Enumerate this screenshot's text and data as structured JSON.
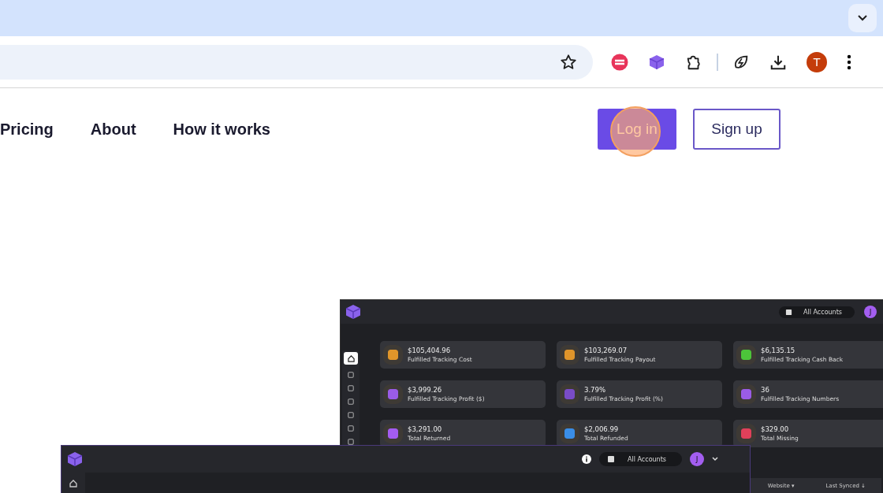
{
  "browser": {
    "avatar_initial": "T"
  },
  "nav": {
    "links": [
      {
        "label": "Pricing"
      },
      {
        "label": "About"
      },
      {
        "label": "How it works"
      }
    ],
    "login": {
      "label": "Log in",
      "click_highlight": true
    },
    "signup": {
      "label": "Sign up"
    }
  },
  "back_dashboard": {
    "account_label": "All Accounts",
    "avatar_initial": "J",
    "cards": [
      {
        "value": "$105,404.96",
        "label": "Fulfilled Tracking Cost",
        "color": "#e0952a"
      },
      {
        "value": "$103,269.07",
        "label": "Fulfilled Tracking Payout",
        "color": "#e0952a"
      },
      {
        "value": "$6,135.15",
        "label": "Fulfilled Tracking Cash Back",
        "color": "#4cc43a"
      },
      {
        "value": "$3,999.26",
        "label": "Fulfilled Tracking Profit ($)",
        "color": "#9a5ce6"
      },
      {
        "value": "3.79%",
        "label": "Fulfilled Tracking Profit (%)",
        "color": "#7a4cc6"
      },
      {
        "value": "36",
        "label": "Fulfilled Tracking Numbers",
        "color": "#9a5ce6"
      },
      {
        "value": "$3,291.00",
        "label": "Total Returned",
        "color": "#a45cf0"
      },
      {
        "value": "$2,006.99",
        "label": "Total Refunded",
        "color": "#3a8ee6"
      },
      {
        "value": "$329.00",
        "label": "Total Missing",
        "color": "#e0405a"
      }
    ],
    "table_columns": [
      "Website ▾",
      "Last Synced ↓"
    ]
  },
  "front_dashboard": {
    "account_label": "All Accounts",
    "avatar_initial": "J"
  }
}
